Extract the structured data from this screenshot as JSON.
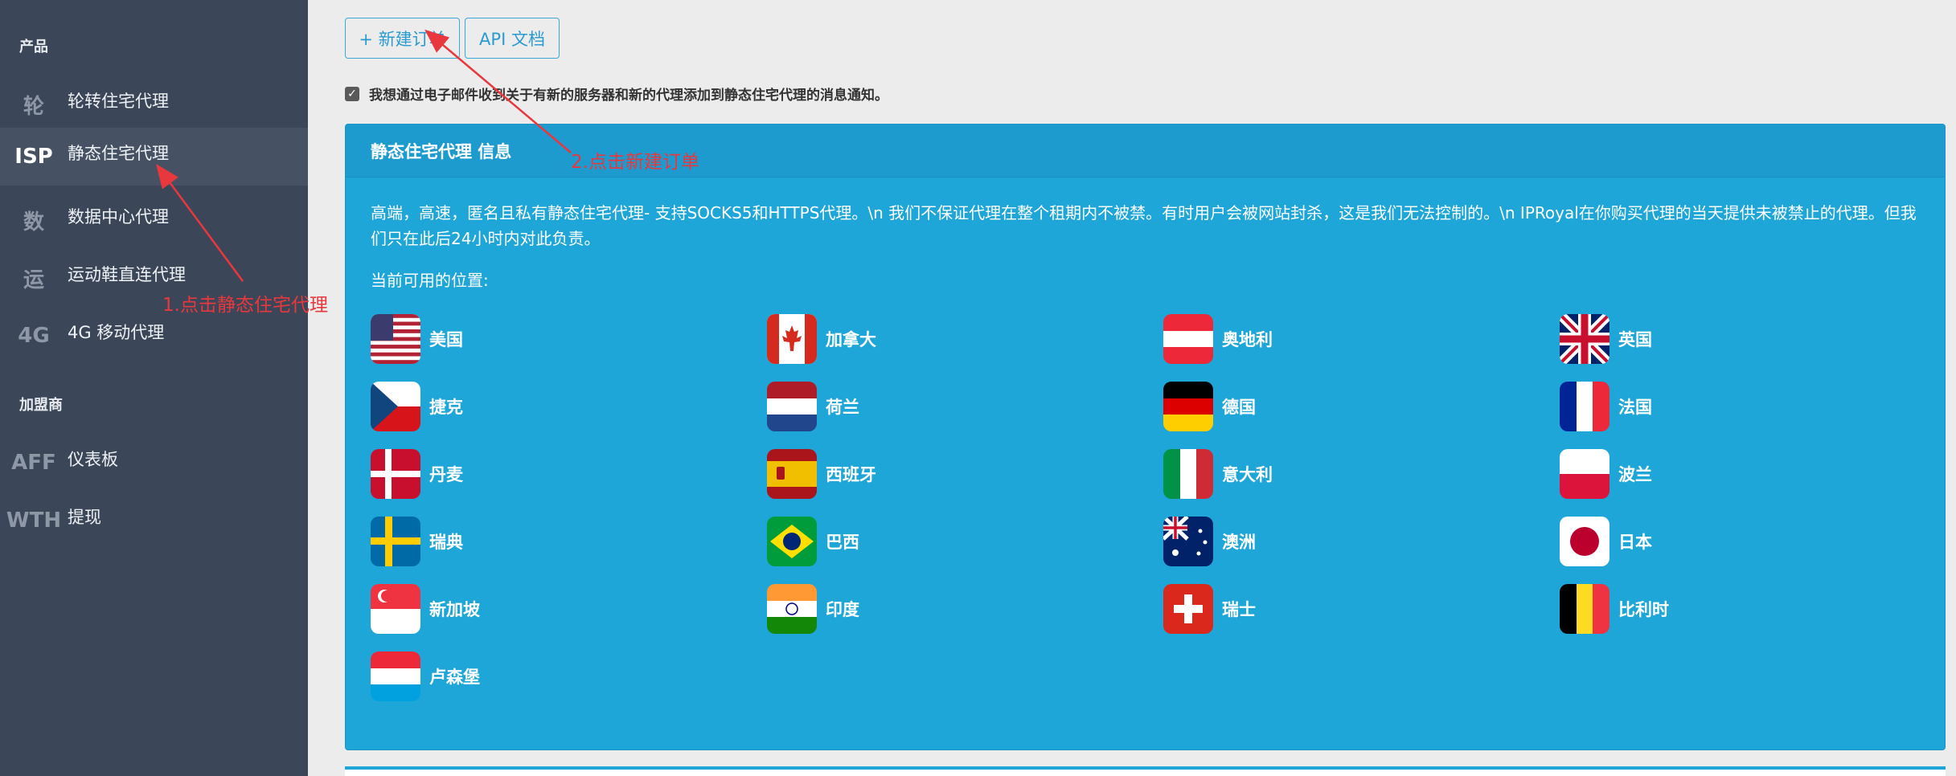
{
  "sidebar": {
    "sections": [
      {
        "title": "产品",
        "items": [
          {
            "abbr": "轮",
            "label": "轮转住宅代理"
          },
          {
            "abbr": "ISP",
            "label": "静态住宅代理"
          },
          {
            "abbr": "数",
            "label": "数据中心代理"
          },
          {
            "abbr": "运",
            "label": "运动鞋直连代理"
          },
          {
            "abbr": "4G",
            "label": "4G 移动代理"
          }
        ]
      },
      {
        "title": "加盟商",
        "items": [
          {
            "abbr": "AFF",
            "label": "仪表板"
          },
          {
            "abbr": "WTH",
            "label": "提现"
          }
        ]
      }
    ]
  },
  "toolbar": {
    "new_order_label": "+ 新建订单",
    "api_docs_label": "API 文档"
  },
  "notify": {
    "checked": true,
    "text": "我想通过电子邮件收到关于有新的服务器和新的代理添加到静态住宅代理的消息通知。"
  },
  "panel": {
    "title": "静态住宅代理 信息",
    "description": "高端，高速，匿名且私有静态住宅代理- 支持SOCKS5和HTTPS代理。\\n 我们不保证代理在整个租期内不被禁。有时用户会被网站封杀，这是我们无法控制的。\\n IPRoyal在你购买代理的当天提供未被禁止的代理。但我们只在此后24小时内对此负责。",
    "available_label": "当前可用的位置:",
    "locations": [
      {
        "name": "美国",
        "flag": "us-flag-icon"
      },
      {
        "name": "加拿大",
        "flag": "ca-flag-icon"
      },
      {
        "name": "奥地利",
        "flag": "at-flag-icon"
      },
      {
        "name": "英国",
        "flag": "gb-flag-icon"
      },
      {
        "name": "捷克",
        "flag": "cz-flag-icon"
      },
      {
        "name": "荷兰",
        "flag": "nl-flag-icon"
      },
      {
        "name": "德国",
        "flag": "de-flag-icon"
      },
      {
        "name": "法国",
        "flag": "fr-flag-icon"
      },
      {
        "name": "丹麦",
        "flag": "dk-flag-icon"
      },
      {
        "name": "西班牙",
        "flag": "es-flag-icon"
      },
      {
        "name": "意大利",
        "flag": "it-flag-icon"
      },
      {
        "name": "波兰",
        "flag": "pl-flag-icon"
      },
      {
        "name": "瑞典",
        "flag": "se-flag-icon"
      },
      {
        "name": "巴西",
        "flag": "br-flag-icon"
      },
      {
        "name": "澳洲",
        "flag": "au-flag-icon"
      },
      {
        "name": "日本",
        "flag": "jp-flag-icon"
      },
      {
        "name": "新加坡",
        "flag": "sg-flag-icon"
      },
      {
        "name": "印度",
        "flag": "in-flag-icon"
      },
      {
        "name": "瑞士",
        "flag": "ch-flag-icon"
      },
      {
        "name": "比利时",
        "flag": "be-flag-icon"
      },
      {
        "name": "卢森堡",
        "flag": "lu-flag-icon"
      }
    ]
  },
  "annotations": {
    "step1": "1.点击静态住宅代理",
    "step2": "2.点击新建订单"
  },
  "colors": {
    "sidebar_bg": "#3b4658",
    "panel_bg": "#1fa6d8",
    "accent": "#2a9bd0",
    "annotation": "#e8383d"
  }
}
